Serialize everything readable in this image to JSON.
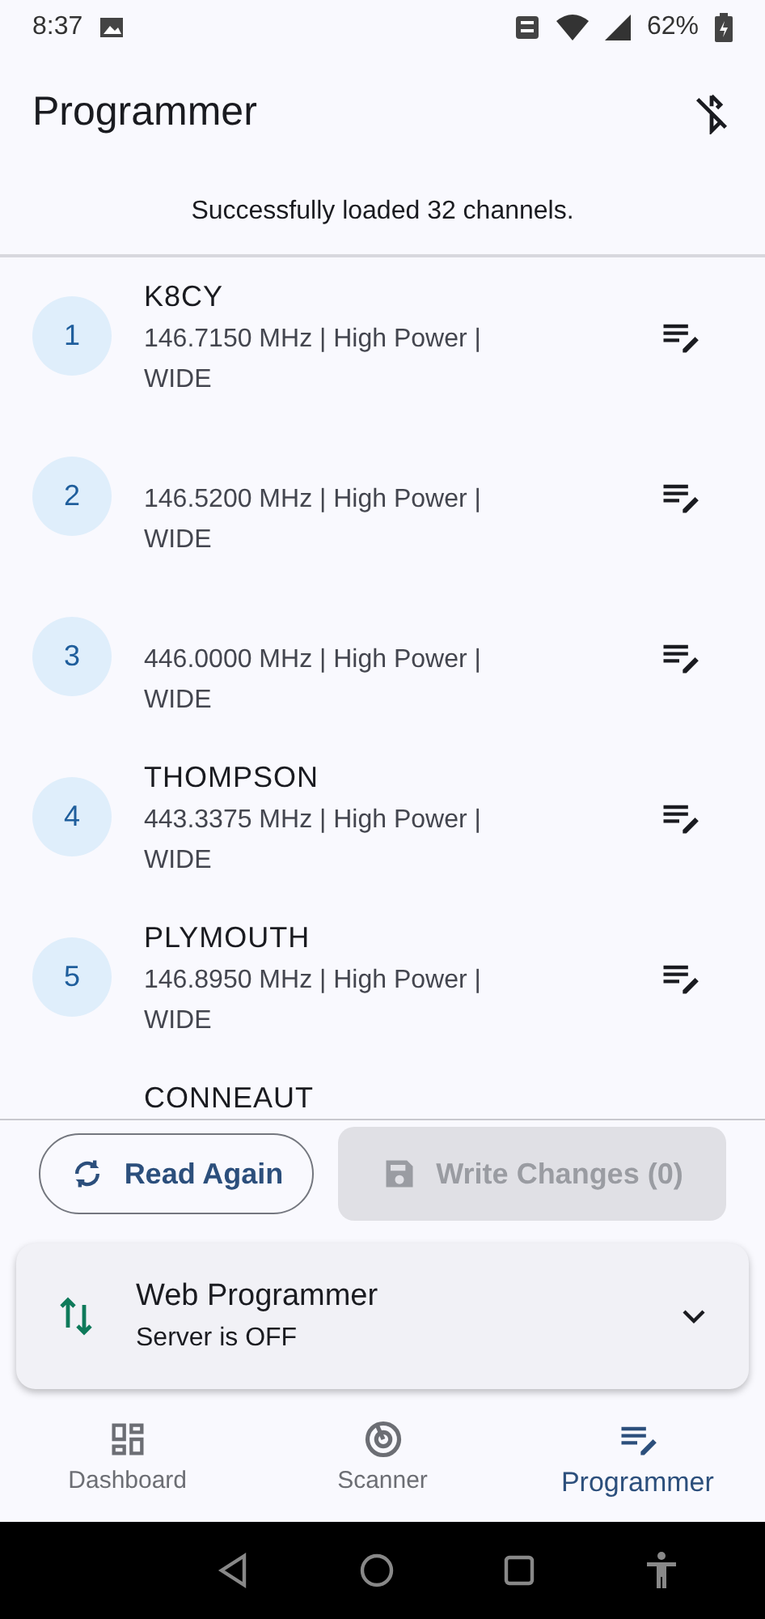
{
  "status_bar": {
    "time": "8:37",
    "battery": "62%"
  },
  "app_bar": {
    "title": "Programmer"
  },
  "message": "Successfully loaded 32 channels.",
  "channels": [
    {
      "number": "1",
      "name": "K8CY",
      "details": "146.7150 MHz | High Power | WIDE"
    },
    {
      "number": "2",
      "details": "146.5200 MHz | High Power | WIDE"
    },
    {
      "number": "3",
      "details": "446.0000 MHz | High Power | WIDE"
    },
    {
      "number": "4",
      "name": "THOMPSON",
      "details": "443.3375 MHz | High Power | WIDE"
    },
    {
      "number": "5",
      "name": "PLYMOUTH",
      "details": "146.8950 MHz | High Power | WIDE"
    },
    {
      "name": "CONNEAUT"
    }
  ],
  "actions": [
    {
      "label": "Read Again",
      "kind": "outlined",
      "disabled": false
    },
    {
      "label": "Write Changes (0)",
      "kind": "filled",
      "disabled": true
    }
  ],
  "web_programmer": {
    "title": "Web Programmer",
    "subtitle": "Server is OFF",
    "expanded": false
  },
  "nav": [
    {
      "label": "Dashboard",
      "selected": false
    },
    {
      "label": "Scanner",
      "selected": false
    },
    {
      "label": "Programmer",
      "selected": true
    }
  ]
}
